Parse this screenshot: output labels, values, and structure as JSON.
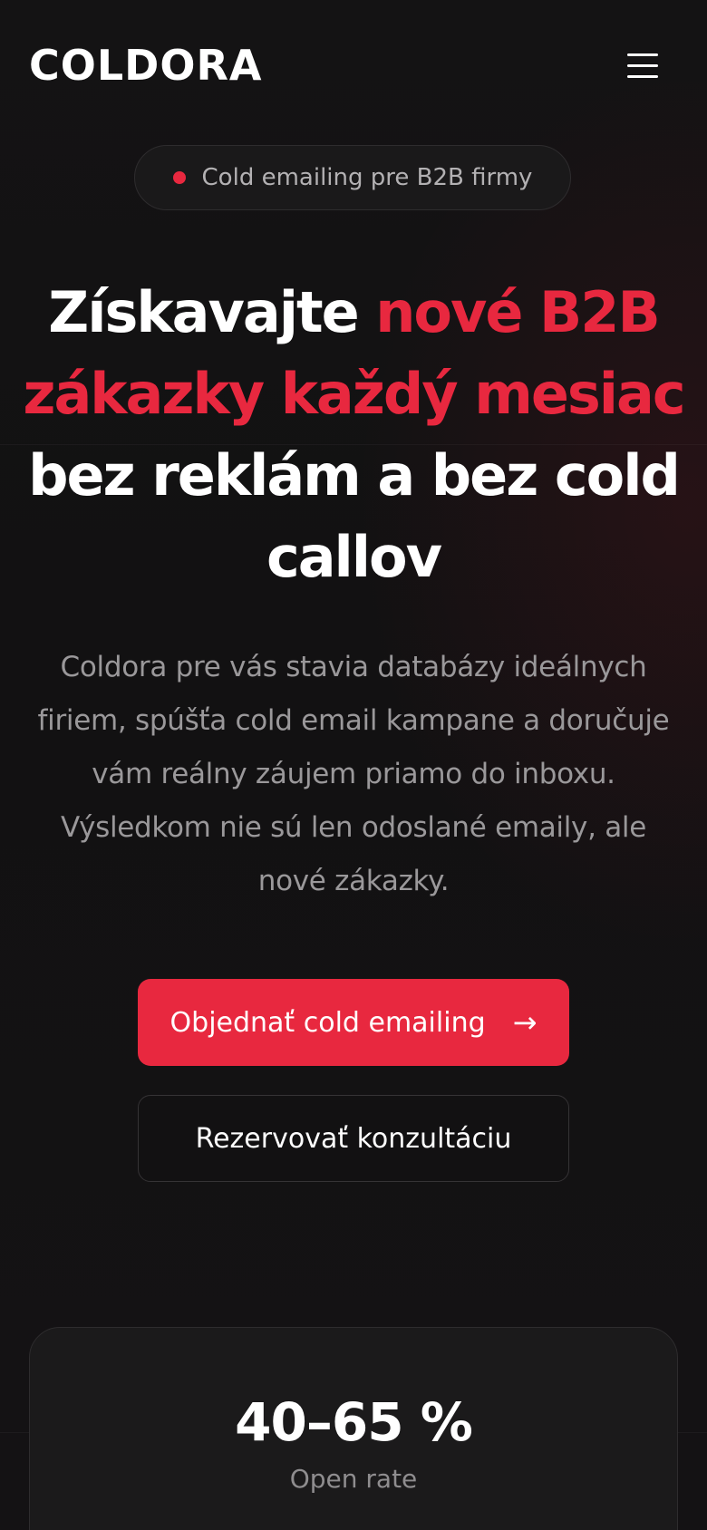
{
  "header": {
    "logo_text": "COLDORA",
    "menu_icon": "hamburger-menu-icon"
  },
  "badge": {
    "text": "Cold emailing pre B2B firmy"
  },
  "hero": {
    "headline_parts": [
      {
        "text": "Získavajte ",
        "color": "white"
      },
      {
        "text": "nové B2B zákazky každý mesiac",
        "color": "red"
      },
      {
        "text": " bez reklám a bez cold callov",
        "color": "white"
      }
    ],
    "description": "Coldora pre vás stavia databázy ideálnych firiem, spúšťa cold email kampane a doručuje vám reálny záujem priamo do inboxu. Výsledkom nie sú len odoslané emaily, ale nové zákazky."
  },
  "cta": {
    "primary_label": "Objednať cold emailing",
    "primary_icon": "arrow-right-icon",
    "secondary_label": "Rezervovať konzultáciu"
  },
  "stats": [
    {
      "value": "40–65 %",
      "label": "Open rate"
    }
  ],
  "colors": {
    "background": "#121112",
    "accent": "#e8283f",
    "text": "#ffffff",
    "muted": "#9a989a"
  }
}
